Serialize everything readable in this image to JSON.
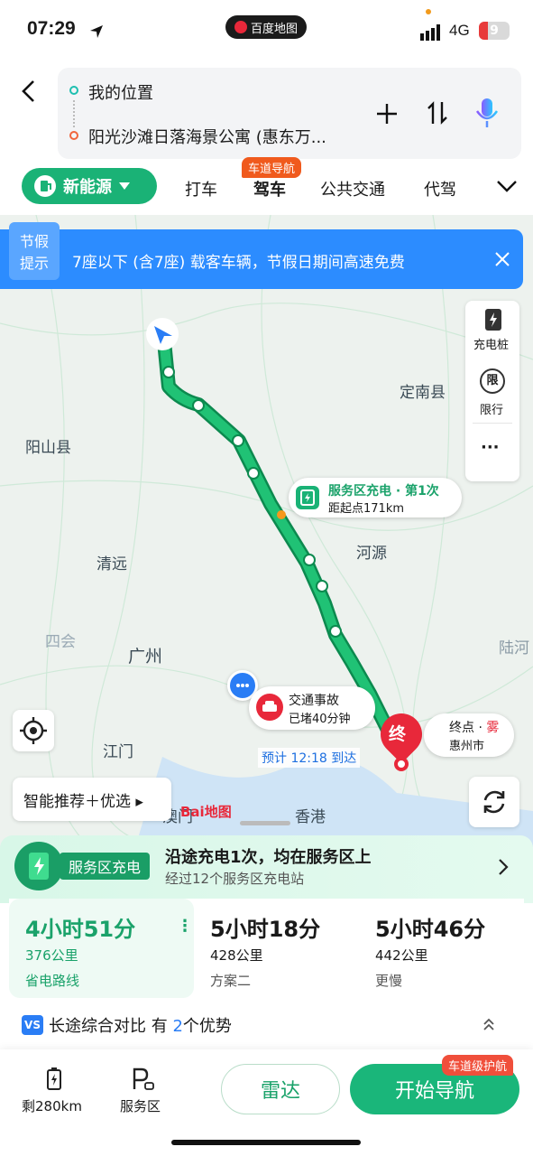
{
  "status": {
    "time": "07:29",
    "app_name": "百度地图",
    "network": "4G",
    "battery": "9"
  },
  "route": {
    "origin": "我的位置",
    "destination": "阳光沙滩日落海景公寓 (惠东万..."
  },
  "tabs": {
    "new_energy": "新能源",
    "items": [
      "打车",
      "驾车",
      "公共交通",
      "代驾"
    ],
    "lane_nav_badge": "车道导航"
  },
  "banner": {
    "tag_line1": "节假",
    "tag_line2": "提示",
    "text": "7座以下 (含7座) 载客车辆，节假日期间高速免费"
  },
  "map": {
    "labels": [
      "阳山县",
      "清远",
      "广州",
      "江门",
      "河源",
      "定南县",
      "香港",
      "陆河",
      "四会",
      "澳门"
    ],
    "sidebar": {
      "charging": "充电桩",
      "limit_icon": "限",
      "limit": "限行",
      "more": "···"
    },
    "service_callout": {
      "title": "服务区充电 · 第1次",
      "sub": "距起点171km"
    },
    "accident_callout": {
      "title": "交通事故",
      "sub": "已堵40分钟"
    },
    "eta": "预计 12:18 到达",
    "end": {
      "marker": "终",
      "label": "终点 · ",
      "weather": "雾",
      "city": "惠州市"
    },
    "smart_recommend": "智能推荐＋优选",
    "logo": "Bai地图"
  },
  "service": {
    "tag": "服务区充电",
    "title": "沿途充电1次，均在服务区上",
    "sub": "经过12个服务区充电站"
  },
  "plans": [
    {
      "time": "4小时51分",
      "distance": "376公里",
      "desc": "省电路线"
    },
    {
      "time": "5小时18分",
      "distance": "428公里",
      "desc": "方案二"
    },
    {
      "time": "5小时46分",
      "distance": "442公里",
      "desc": "更慢"
    }
  ],
  "compare": {
    "label": "长途综合对比 有",
    "count": "2",
    "suffix": "个优势"
  },
  "actions": {
    "remaining": "剩280km",
    "service_area": "服务区",
    "radar": "雷达",
    "start": "开始导航",
    "lane_badge": "车道级护航"
  },
  "colors": {
    "green": "#1ab276",
    "blue": "#2c8cff",
    "red": "#e8283a"
  }
}
